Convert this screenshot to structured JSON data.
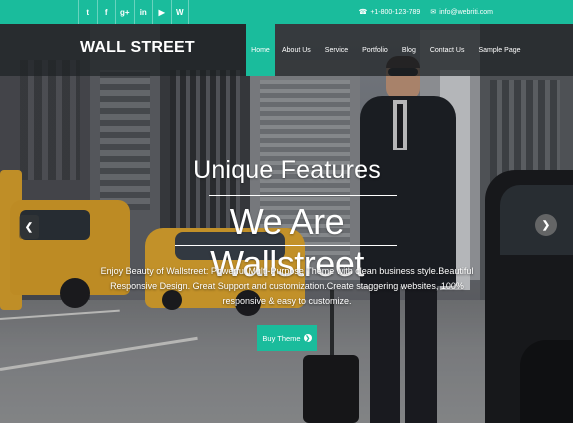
{
  "topbar": {
    "social_icons": [
      {
        "name": "twitter-icon",
        "glyph": "t"
      },
      {
        "name": "facebook-icon",
        "glyph": "f"
      },
      {
        "name": "google-plus-icon",
        "glyph": "g+"
      },
      {
        "name": "linkedin-icon",
        "glyph": "in"
      },
      {
        "name": "youtube-icon",
        "glyph": "▶"
      },
      {
        "name": "wordpress-icon",
        "glyph": "W"
      }
    ],
    "phone_icon": "☎",
    "phone": "+1-800-123-789",
    "email_icon": "✉",
    "email": "info@webriti.com",
    "accent_color": "#1abc9c"
  },
  "header": {
    "brand": "WALL STREET",
    "menu": [
      {
        "label": "Home",
        "active": true
      },
      {
        "label": "About Us",
        "active": false
      },
      {
        "label": "Service",
        "active": false
      },
      {
        "label": "Portfolio",
        "active": false
      },
      {
        "label": "Blog",
        "active": false
      },
      {
        "label": "Contact Us",
        "active": false
      },
      {
        "label": "Sample Page",
        "active": false
      }
    ]
  },
  "hero": {
    "subtitle": "Unique Features",
    "title": "We Are Wallstreet",
    "description": "Enjoy Beauty of Wallstreet: Powerful Multi-Purpose Theme with clean business style.Beautiful Responsive Design. Great Support and customization.Create staggering websites, 100% responsive & easy to customize.",
    "button_label": "Buy Theme",
    "button_icon": "❯",
    "prev_arrow": "❮",
    "next_arrow": "❯"
  }
}
